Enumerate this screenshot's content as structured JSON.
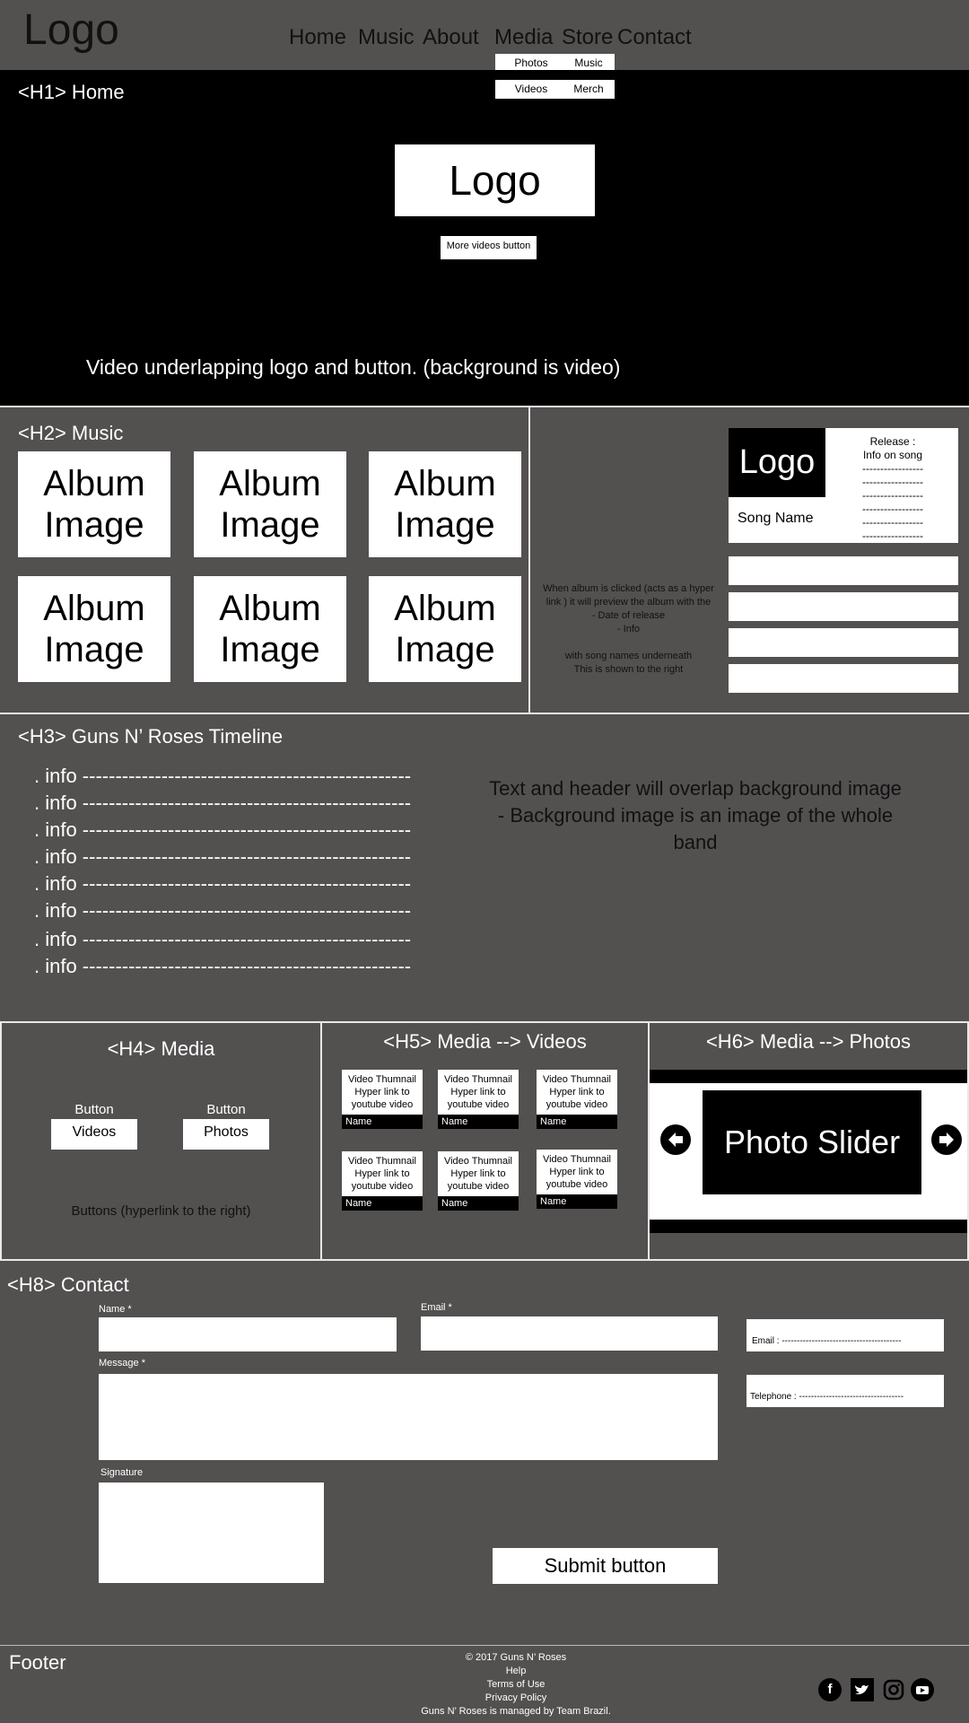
{
  "header": {
    "logo": "Logo",
    "nav": [
      "Home",
      "Music",
      "About",
      "Media",
      "Store",
      "Contact"
    ],
    "media_sub": [
      "Photos",
      "Videos"
    ],
    "store_sub": [
      "Music",
      "Merch"
    ]
  },
  "hero": {
    "heading": "<H1> Home",
    "logo": "Logo",
    "more_videos_button": "More videos button",
    "caption": "Video underlapping logo and button. (background is video)"
  },
  "music": {
    "heading": "<H2> Music",
    "albums": [
      [
        "Album",
        "Image"
      ],
      [
        "Album",
        "Image"
      ],
      [
        "Album",
        "Image"
      ],
      [
        "Album",
        "Image"
      ],
      [
        "Album",
        "Image"
      ],
      [
        "Album",
        "Image"
      ]
    ],
    "note_lines": [
      "When album is clicked (acts as a hyper",
      "link ) it will preview the album with the",
      "- Date of release",
      "- Info",
      "",
      "with song names underneath",
      "This is shown to the right"
    ],
    "preview": {
      "logo": "Logo",
      "song_name": "Song Name",
      "release": "Release :",
      "info": "Info on song",
      "dashes": [
        "-----------------",
        "-----------------",
        "-----------------",
        "-----------------",
        "-----------------",
        "-----------------"
      ]
    }
  },
  "timeline": {
    "heading": "<H3> Guns N’ Roses Timeline",
    "items": [
      ". info --------------------------------------------------",
      ". info --------------------------------------------------",
      ". info --------------------------------------------------",
      ". info --------------------------------------------------",
      ". info --------------------------------------------------",
      ". info --------------------------------------------------",
      ". info --------------------------------------------------",
      ". info --------------------------------------------------"
    ],
    "overlay_text": [
      "Text and header will overlap background image",
      "- Background image is an image of the whole",
      "band"
    ]
  },
  "media": {
    "heading": "<H4> Media",
    "button_caption_1": "Button",
    "button_caption_2": "Button",
    "videos_button": "Videos",
    "photos_button": "Photos",
    "note": "Buttons (hyperlink to the right)"
  },
  "videos": {
    "heading": "<H5> Media --> Videos",
    "thumbs": [
      {
        "line1": "Video Thumnail",
        "line2": "Hyper link to",
        "line3": "youtube video",
        "name": "Name"
      },
      {
        "line1": "Video Thumnail",
        "line2": "Hyper link to",
        "line3": "youtube video",
        "name": "Name"
      },
      {
        "line1": "Video Thumnail",
        "line2": "Hyper link to",
        "line3": "youtube video",
        "name": "Name"
      },
      {
        "line1": "Video Thumnail",
        "line2": "Hyper link to",
        "line3": "youtube video",
        "name": "Name"
      },
      {
        "line1": "Video Thumnail",
        "line2": "Hyper link to",
        "line3": "youtube video",
        "name": "Name"
      },
      {
        "line1": "Video Thumnail",
        "line2": "Hyper link to",
        "line3": "youtube video",
        "name": "Name"
      }
    ]
  },
  "photos": {
    "heading": "<H6> Media --> Photos",
    "slider": "Photo Slider"
  },
  "contact": {
    "heading": "<H8> Contact",
    "name_label": "Name *",
    "email_label": "Email *",
    "message_label": "Message *",
    "signature_label": "Signature",
    "submit": "Submit button",
    "email_info": "Email : ----------------------------------------",
    "telephone_info": "Telephone : -----------------------------------"
  },
  "footer": {
    "label": "Footer",
    "lines": [
      "© 2017 Guns N’ Roses",
      "Help",
      "Terms of Use",
      "Privacy Policy",
      "Guns N’ Roses is managed by Team Brazil."
    ],
    "social": [
      "facebook-icon",
      "twitter-icon",
      "instagram-icon",
      "youtube-icon"
    ]
  }
}
